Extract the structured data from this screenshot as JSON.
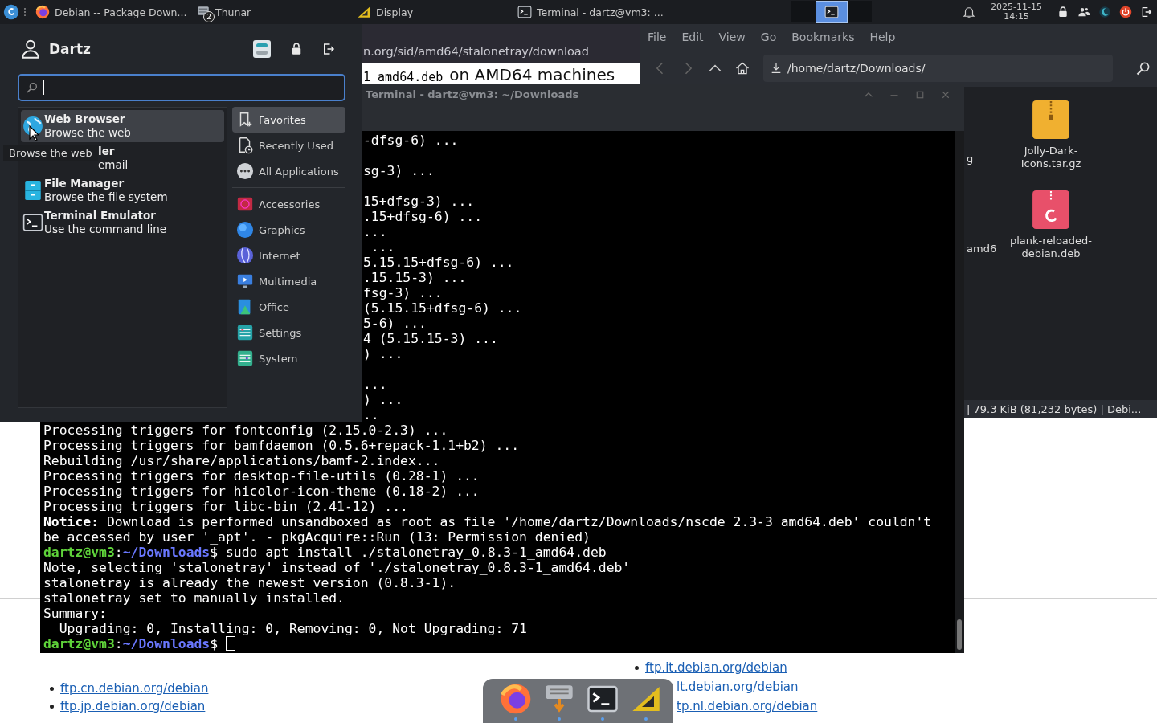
{
  "panel": {
    "tasks": [
      {
        "kind": "firefox",
        "label": "Debian -- Package Down..."
      },
      {
        "kind": "thunar",
        "label": "Thunar",
        "badge": "2"
      },
      {
        "kind": "display",
        "label": "Display"
      },
      {
        "kind": "terminal",
        "label": "Terminal - dartz@vm3: ..."
      }
    ],
    "workspaces": [
      {
        "selected": false
      },
      {
        "selected": true
      },
      {
        "selected": false
      }
    ],
    "clock": {
      "date": "2025-11-15",
      "time": "14:15"
    }
  },
  "browser": {
    "url_fragment": "n.org/sid/amd64/stalonetray/download",
    "code_fragment": "1 amd64.deb",
    "text_fragment": "on AMD64 machines",
    "links_left": [
      "ftp.cn.debian.org/debian",
      "ftp.jp.debian.org/debian"
    ],
    "links_right": [
      {
        "label": "ftp.it.debian.org/debian",
        "covered": false
      },
      {
        "label": "lt.debian.org/debian",
        "covered": true
      },
      {
        "label": "tp.nl.debian.org/debian",
        "covered": true
      }
    ]
  },
  "thunar": {
    "menu": [
      "File",
      "Edit",
      "View",
      "Go",
      "Bookmarks",
      "Help"
    ],
    "location": "/home/dartz/Downloads/",
    "rows": [
      {
        "fragment": "g",
        "file": {
          "kind": "archive",
          "name": "Jolly-Dark-Icons.tar.gz"
        }
      },
      {
        "fragment": "amd6",
        "file": {
          "kind": "deb",
          "name": "plank-reloaded-debian.deb"
        }
      }
    ],
    "status": "| 79.3 KiB (81,232 bytes) | Debi..."
  },
  "terminal": {
    "title": "Terminal - dartz@vm3: ~/Downloads",
    "lines": [
      {
        "kind": "fragment",
        "text": "-dfsg-6) ..."
      },
      {
        "kind": "blank"
      },
      {
        "kind": "fragment",
        "text": "sg-3) ..."
      },
      {
        "kind": "blank"
      },
      {
        "kind": "fragment",
        "text": "15+dfsg-3) ..."
      },
      {
        "kind": "fragment",
        "text": ".15+dfsg-6) ..."
      },
      {
        "kind": "fragment",
        "text": "..."
      },
      {
        "kind": "fragment",
        "text": " ..."
      },
      {
        "kind": "fragment",
        "text": "5.15.15+dfsg-6) ..."
      },
      {
        "kind": "fragment",
        "text": ".15.15-3) ..."
      },
      {
        "kind": "fragment",
        "text": "fsg-3) ..."
      },
      {
        "kind": "fragment",
        "text": "(5.15.15+dfsg-6) ..."
      },
      {
        "kind": "fragment",
        "text": "5-6) ..."
      },
      {
        "kind": "fragment",
        "text": "4 (5.15.15-3) ..."
      },
      {
        "kind": "fragment",
        "text": ") ..."
      },
      {
        "kind": "blank"
      },
      {
        "kind": "fragment",
        "text": "..."
      },
      {
        "kind": "fragment",
        "text": ") ..."
      },
      {
        "kind": "fragment",
        "text": ".."
      },
      {
        "kind": "text",
        "text": "Processing triggers for fontconfig (2.15.0-2.3) ..."
      },
      {
        "kind": "text",
        "text": "Processing triggers for bamfdaemon (0.5.6+repack-1.1+b2) ..."
      },
      {
        "kind": "text",
        "text": "Rebuilding /usr/share/applications/bamf-2.index..."
      },
      {
        "kind": "text",
        "text": "Processing triggers for desktop-file-utils (0.28-1) ..."
      },
      {
        "kind": "text",
        "text": "Processing triggers for hicolor-icon-theme (0.18-2) ..."
      },
      {
        "kind": "text",
        "text": "Processing triggers for libc-bin (2.41-12) ..."
      },
      {
        "kind": "text",
        "text": "**Notice:** Download is performed unsandboxed as root as file '/home/dartz/Downloads/nscde_2.3-3_amd64.deb' couldn't"
      },
      {
        "kind": "text",
        "text": "be accessed by user '_apt'. - pkgAcquire::Run (13: Permission denied)"
      },
      {
        "kind": "prompt",
        "user": "dartz@vm3",
        "separator": ":",
        "path": "~/Downloads",
        "command": "$ sudo apt install ./stalonetray_0.8.3-1_amd64.deb",
        "cursor": false
      },
      {
        "kind": "text",
        "text": "Note, selecting 'stalonetray' instead of './stalonetray_0.8.3-1_amd64.deb'"
      },
      {
        "kind": "text",
        "text": "stalonetray is already the newest version (0.8.3-1)."
      },
      {
        "kind": "text",
        "text": "stalonetray set to manually installed."
      },
      {
        "kind": "text",
        "text": "Summary:"
      },
      {
        "kind": "text",
        "text": "  Upgrading: 0, Installing: 0, Removing: 0, Not Upgrading: 71"
      },
      {
        "kind": "prompt",
        "user": "dartz@vm3",
        "separator": ":",
        "path": "~/Downloads",
        "command": "$ ",
        "cursor": true
      }
    ]
  },
  "menu": {
    "user": "Dartz",
    "tooltip": "Browse the web",
    "apps": [
      {
        "kind": "browser",
        "name": "Web Browser",
        "description": "Browse the web",
        "selected": true,
        "obscured": false
      },
      {
        "name": "ler",
        "description": "email",
        "selected": false,
        "obscured": true
      },
      {
        "kind": "files",
        "name": "File Manager",
        "description": "Browse the file system",
        "selected": false,
        "obscured": false
      },
      {
        "kind": "terminal",
        "name": "Terminal Emulator",
        "description": "Use the command line",
        "selected": false,
        "obscured": false
      }
    ],
    "views": [
      {
        "kind": "favorites",
        "label": "Favorites",
        "selected": true
      },
      {
        "kind": "recent",
        "label": "Recently Used",
        "selected": false
      },
      {
        "kind": "all",
        "label": "All Applications",
        "selected": false
      }
    ],
    "categories": [
      {
        "kind": "accessories",
        "label": "Accessories"
      },
      {
        "kind": "graphics",
        "label": "Graphics"
      },
      {
        "kind": "internet",
        "label": "Internet"
      },
      {
        "kind": "multimedia",
        "label": "Multimedia"
      },
      {
        "kind": "office",
        "label": "Office"
      },
      {
        "kind": "settings",
        "label": "Settings"
      },
      {
        "kind": "system",
        "label": "System"
      }
    ]
  },
  "dock": [
    {
      "kind": "firefox",
      "running": true
    },
    {
      "kind": "input",
      "running": true
    },
    {
      "kind": "terminal",
      "running": true
    },
    {
      "kind": "display",
      "running": true
    }
  ]
}
